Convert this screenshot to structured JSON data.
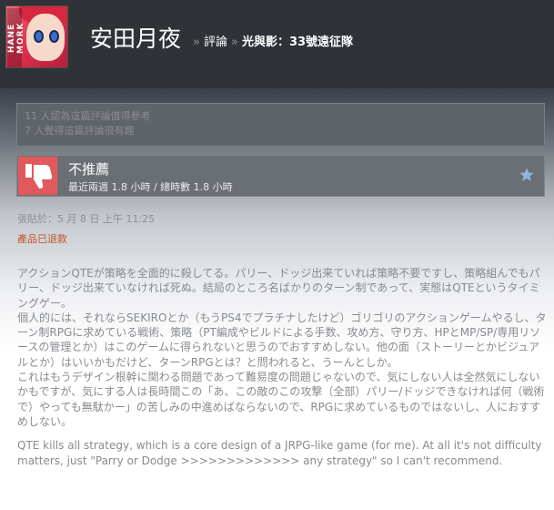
{
  "header": {
    "avatar_logo_text": "HANE MORK",
    "username": "安田月夜",
    "breadcrumb": {
      "separator": "»",
      "reviews_label": "評論",
      "game_title": "光與影：33號遠征隊"
    }
  },
  "helpful_box": {
    "line1": "11 人認為這篇評論值得參考",
    "line2": "7 人覺得這篇評論很有趣"
  },
  "review": {
    "verdict": "不推薦",
    "hours": "最近兩週 1.8 小時 / 總時數 1.8 小時",
    "posted": "張貼於：5 月 8 日 上午 11:25",
    "refunded": "產品已退款",
    "paragraph_jp": "アクションQTEが策略を全面的に殺してる。パリー、ドッジ出来ていれば策略不要ですし、策略組んでもパリー、ドッジ出来ていなければ死ぬ。結局のところ名ばかりのターン制であって、実態はQTEというタイミングゲー。\n個人的には、それならSEKIROとか（もうPS4でプラチナしたけど）ゴリゴリのアクションゲームやるし、ターン制RPGに求めている戦術、策略（PT編成やビルドによる手数、攻め方、守り方、HPとMP/SP/専用リソースの管理とか）はこのゲームに得られないと思うのでおすすめしない。他の面（ストーリーとかビジュアルとか）はいいかもだけど、ターンRPGとは？と問われると、うーんとしか。\nこれはもうデザイン根幹に関わる問題であって難易度の問題じゃないので、気にしない人は全然気にしないかもですが、気にする人は長時間この「あ、この敵のこの攻撃（全部）パリー/ドッジできなければ何（戦術で）やっても無駄かー」の苦しみの中進めばならないので、RPGに求めているものではないし、人におすすめしない。",
    "paragraph_en": "QTE kills all strategy, which is a core design of a JRPG-like game (for me). At all it's not difficulty matters, just \"Parry or Dodge >>>>>>>>>>>>> any strategy\" so I can't recommend."
  },
  "icons": {
    "thumb": "thumbs-down-icon",
    "star": "star-icon"
  },
  "colors": {
    "header_bg": "#2f3236",
    "thumb_bg": "#e2595d",
    "refund_text": "#c4522a",
    "star": "#8fb3d9"
  }
}
